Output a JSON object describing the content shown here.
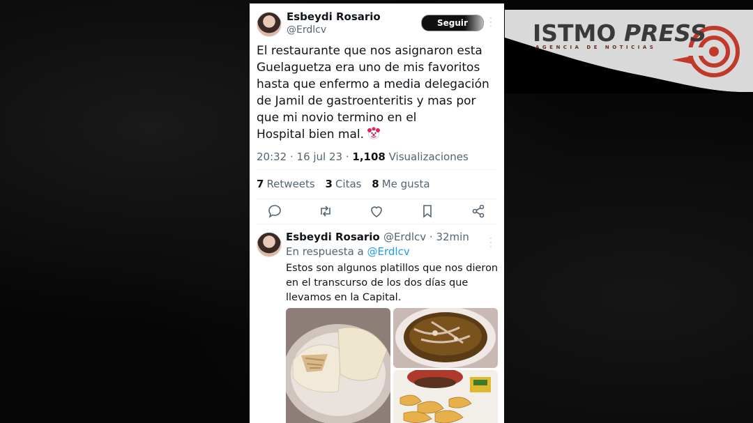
{
  "logo": {
    "main": "ISTMO",
    "press": "PRESS",
    "sub": "AGENCIA DE NOTICIAS"
  },
  "tweet": {
    "author_name": "Esbeydi Rosario",
    "author_handle": "@Erdlcv",
    "follow_label": "Seguir",
    "lines": [
      "El restaurante que nos asignaron esta",
      "Guelaguetza era uno de mis favoritos",
      "hasta que enfermo a media delegación",
      "de Jamil de gastroenteritis y mas por",
      "que mi novio termino en el",
      "Hospital bien mal."
    ],
    "emoji": "clown-face-emoji",
    "time_date": "20:32 · 16 jul 23 · ",
    "views_count": "1,108",
    "views_label": "Visualizaciones",
    "retweets_count": "7",
    "retweets_label": "Retweets",
    "quotes_count": "3",
    "quotes_label": "Citas",
    "likes_count": "8",
    "likes_label": "Me gusta",
    "action_icons": [
      "reply-icon",
      "retweet-icon",
      "like-icon",
      "bookmark-icon",
      "share-icon"
    ]
  },
  "reply": {
    "author_name": "Esbeydi Rosario",
    "author_handle": "@Erdlcv",
    "sep": " · ",
    "time": "32min",
    "in_reply_prefix": "En respuesta a ",
    "in_reply_handle": "@Erdlcv",
    "lines": [
      "Estos son algunos platillos que nos dieron",
      "en el transcurso de los dos días que",
      "llevamos en la Capital."
    ],
    "photos": [
      "tacos-photo",
      "soup-photo",
      "fries-photo"
    ]
  },
  "colors": {
    "link": "#1d9bf0",
    "muted": "#536471",
    "text": "#0f1419",
    "logo_red": "#c0392b"
  }
}
